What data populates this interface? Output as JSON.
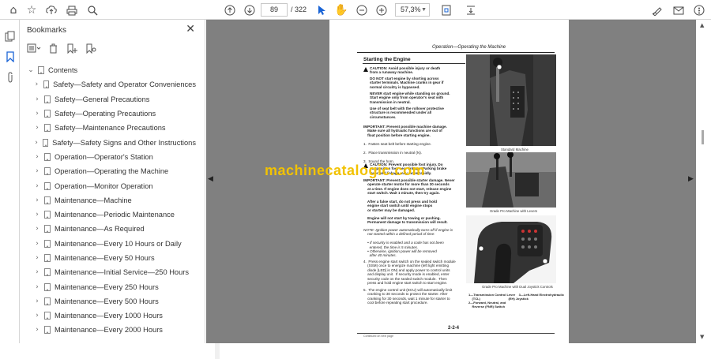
{
  "toolbar": {
    "page_current": "89",
    "page_total": "/ 322",
    "zoom": "57,3%",
    "icons": [
      "home-icon",
      "star-icon",
      "upload-icon",
      "print-icon",
      "search-zoom-icon",
      "page-up-icon",
      "page-down-icon",
      "cursor-icon",
      "hand-icon",
      "zoom-out-icon",
      "zoom-in-icon",
      "fit-page-icon",
      "scroll-mode-icon",
      "sign-icon",
      "mail-icon",
      "gear-icon"
    ]
  },
  "bookmarks": {
    "title": "Bookmarks",
    "root": "Contents",
    "items": [
      "Safety—Safety and Operator Conveniences",
      "Safety—General Precautions",
      "Safety—Operating Precautions",
      "Safety—Maintenance Precautions",
      "Safety—Safety Signs and Other Instructions",
      "Operation—Operator's Station",
      "Operation—Operating the Machine",
      "Operation—Monitor Operation",
      "Maintenance—Machine",
      "Maintenance—Periodic Maintenance",
      "Maintenance—As Required",
      "Maintenance—Every 10 Hours or Daily",
      "Maintenance—Every 50 Hours",
      "Maintenance—Initial Service—250 Hours",
      "Maintenance—Every 250 Hours",
      "Maintenance—Every 500 Hours",
      "Maintenance—Every 1000 Hours",
      "Maintenance—Every 2000 Hours"
    ]
  },
  "document": {
    "header": "Operation—Operating the Machine",
    "section_title": "Starting the Engine",
    "caution1": "CAUTION: Avoid possible injury or death\nfrom a runaway machine.",
    "para1": "DO NOT start engine by shorting across\nstarter terminals. Machine cranks in gear if\nnormal circuitry is bypassed.",
    "para2": "NEVER start engine while standing on ground.\nStart engine only from operator's seat with\ntransmission in neutral.",
    "para3": "Use of seat belt with the rollover protective\nstructure is recommended under all\ncircumstances.",
    "important1": "IMPORTANT: Prevent possible machine damage.\n    Make sure all hydraulic functions are out of\n    float position before starting engine.",
    "steps123": "1.  Fasten seat belt before starting engine.\n\n2.  Place transmission in neutral (N).\n\n3.  Sound the horn.",
    "caution2": "CAUTION: Prevent possible foot injury. Do\nnot position foot near linkage. Parking brake\nlever and linkage may move rapidly.",
    "important2": "IMPORTANT: Prevent possible starter damage. Never\n    operate starter motor for more than 30 seconds\n    at a time. If engine does not start, release engine\n    start switch. Wait 1 minute, then try again.",
    "para4": "    After a false start, do not press and hold\n    engine start switch until engine stops\n    or starter may be damaged.",
    "para5": "    Engine will not start by towing or pushing.\n    Permanent damage to transmission will result.",
    "note": "NOTE: Ignition power automatically turns off if engine is\n    not started within a defined period of time:\n\n    • If security is enabled and a code has not been\n      entered, the time is 5 minutes.\n    • Otherwise, ignition power will be removed\n      after 40 minutes.",
    "step4": "4.  Press engine start switch on the sealed switch module\n    (SSM) once to energize machine (left light emitting\n    diode [LED] is ON) and apply power to control units\n    and display unit.  If security mode is enabled, enter\n    security code on the sealed switch module.  Then\n    press and hold engine start switch to start engine.",
    "step5": "5.  The engine control unit (ECU) will automatically limit\n    cranking to 30 seconds to protect the starter. After\n    cranking for 30 seconds, wait 1 minute for starter to\n    cool before repeating start procedure.",
    "cap1": "Standard Machine",
    "cap2": "Grade Pro Machine with Levers",
    "cap3": "Grade Pro Machine with Dual Joystick Controls",
    "legend": "1—Transmission Control Lever    3—Left-Hand Electrohydraulic\n    (TCL)                                (EH) Joystick\n2—Forward, Neutral, and\n    Reverse (FNR) Switch",
    "page_number": "2-2-4",
    "continued": "Continued on next page",
    "watermark": "machinecatalogic.com"
  },
  "colors": {
    "accent": "#1a64d6",
    "doc_bg": "#808080",
    "watermark": "#f2c200"
  }
}
